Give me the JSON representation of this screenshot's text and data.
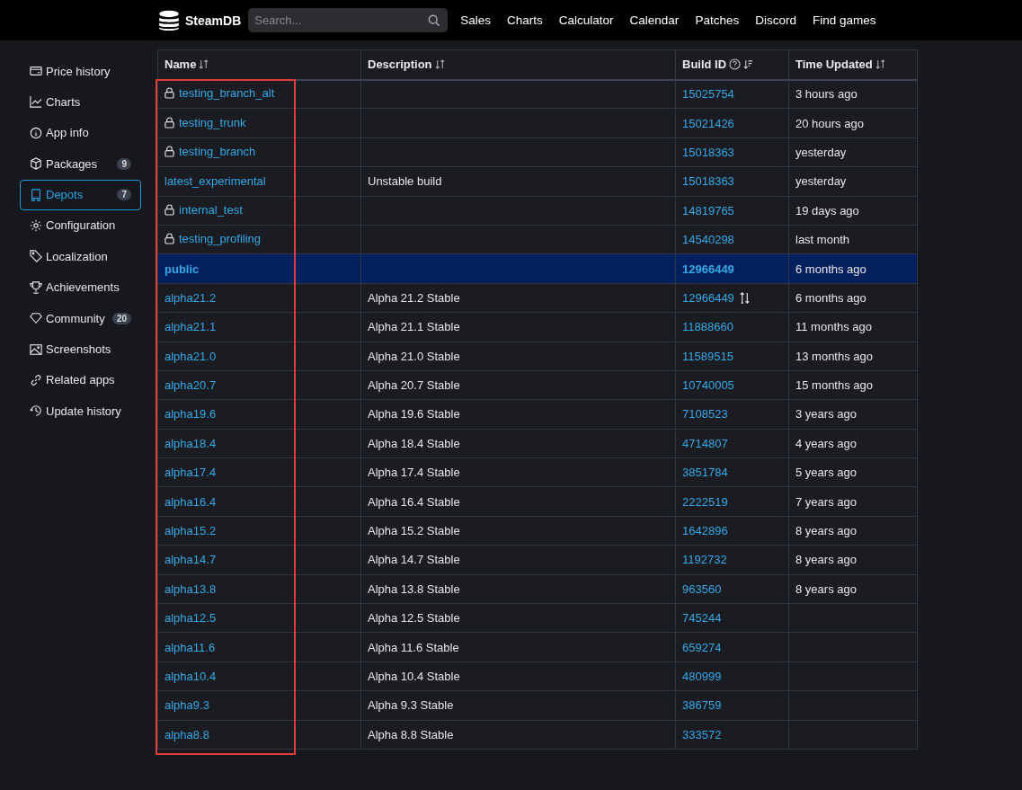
{
  "header": {
    "logo": "SteamDB",
    "search": {
      "placeholder": "Search..."
    },
    "nav": [
      "Sales",
      "Charts",
      "Calculator",
      "Calendar",
      "Patches",
      "Discord",
      "Find games"
    ]
  },
  "sidebar": {
    "items": [
      {
        "label": "Price history",
        "selected": false
      },
      {
        "label": "Charts",
        "selected": false
      },
      {
        "label": "App info",
        "selected": false
      },
      {
        "label": "Packages",
        "count": "9",
        "selected": false
      },
      {
        "label": "Depots",
        "count": "7",
        "selected": true
      },
      {
        "label": "Configuration",
        "selected": false
      },
      {
        "label": "Localization",
        "selected": false
      },
      {
        "label": "Achievements",
        "selected": false
      },
      {
        "label": "Community",
        "count": "20",
        "selected": false
      },
      {
        "label": "Screenshots",
        "selected": false
      },
      {
        "label": "Related apps",
        "selected": false
      },
      {
        "label": "Update history",
        "selected": false
      }
    ]
  },
  "table": {
    "columns": [
      {
        "label": "Name",
        "kind": "sort"
      },
      {
        "label": "Description",
        "kind": "sort"
      },
      {
        "label": "Build ID",
        "kind": "help-sorted"
      },
      {
        "label": "Time Updated",
        "kind": "sort"
      }
    ],
    "rows": [
      {
        "name": "testing_branch_alt",
        "locked": true,
        "build": "15025754",
        "time": "3 hours ago",
        "selected": false,
        "swapped": false
      },
      {
        "name": "testing_trunk",
        "locked": true,
        "build": "15021426",
        "time": "20 hours ago",
        "selected": false,
        "swapped": false
      },
      {
        "name": "testing_branch",
        "locked": true,
        "build": "15018363",
        "time": "yesterday",
        "selected": false,
        "swapped": false
      },
      {
        "name": "latest_experimental",
        "locked": false,
        "description": "Unstable build",
        "build": "15018363",
        "time": "yesterday",
        "selected": false,
        "swapped": false
      },
      {
        "name": "internal_test",
        "locked": true,
        "build": "14819765",
        "time": "19 days ago",
        "selected": false,
        "swapped": false
      },
      {
        "name": "testing_profiling",
        "locked": true,
        "build": "14540298",
        "time": "last month",
        "selected": false,
        "swapped": false
      },
      {
        "name": "public",
        "locked": false,
        "build": "12966449",
        "time": "6 months ago",
        "selected": true,
        "swapped": false
      },
      {
        "name": "alpha21.2",
        "locked": false,
        "description": "Alpha 21.2 Stable",
        "build": "12966449",
        "time": "6 months ago",
        "selected": false,
        "swapped": true
      },
      {
        "name": "alpha21.1",
        "locked": false,
        "description": "Alpha 21.1 Stable",
        "build": "11888660",
        "time": "11 months ago",
        "selected": false,
        "swapped": false
      },
      {
        "name": "alpha21.0",
        "locked": false,
        "description": "Alpha 21.0 Stable",
        "build": "11589515",
        "time": "13 months ago",
        "selected": false,
        "swapped": false
      },
      {
        "name": "alpha20.7",
        "locked": false,
        "description": "Alpha 20.7 Stable",
        "build": "10740005",
        "time": "15 months ago",
        "selected": false,
        "swapped": false
      },
      {
        "name": "alpha19.6",
        "locked": false,
        "description": "Alpha 19.6 Stable",
        "build": "7108523",
        "time": "3 years ago",
        "selected": false,
        "swapped": false
      },
      {
        "name": "alpha18.4",
        "locked": false,
        "description": "Alpha 18.4 Stable",
        "build": "4714807",
        "time": "4 years ago",
        "selected": false,
        "swapped": false
      },
      {
        "name": "alpha17.4",
        "locked": false,
        "description": "Alpha 17.4 Stable",
        "build": "3851784",
        "time": "5 years ago",
        "selected": false,
        "swapped": false
      },
      {
        "name": "alpha16.4",
        "locked": false,
        "description": "Alpha 16.4 Stable",
        "build": "2222519",
        "time": "7 years ago",
        "selected": false,
        "swapped": false
      },
      {
        "name": "alpha15.2",
        "locked": false,
        "description": "Alpha 15.2 Stable",
        "build": "1642896",
        "time": "8 years ago",
        "selected": false,
        "swapped": false
      },
      {
        "name": "alpha14.7",
        "locked": false,
        "description": "Alpha 14.7 Stable",
        "build": "1192732",
        "time": "8 years ago",
        "selected": false,
        "swapped": false
      },
      {
        "name": "alpha13.8",
        "locked": false,
        "description": "Alpha 13.8 Stable",
        "build": "963560",
        "time": "8 years ago",
        "selected": false,
        "swapped": false
      },
      {
        "name": "alpha12.5",
        "locked": false,
        "description": "Alpha 12.5 Stable",
        "build": "745244",
        "selected": false,
        "swapped": false
      },
      {
        "name": "alpha11.6",
        "locked": false,
        "description": "Alpha 11.6 Stable",
        "build": "659274",
        "selected": false,
        "swapped": false
      },
      {
        "name": "alpha10.4",
        "locked": false,
        "description": "Alpha 10.4 Stable",
        "build": "480999",
        "selected": false,
        "swapped": false
      },
      {
        "name": "alpha9.3",
        "locked": false,
        "description": "Alpha 9.3 Stable",
        "build": "386759",
        "selected": false,
        "swapped": false
      },
      {
        "name": "alpha8.8",
        "locked": false,
        "description": "Alpha 8.8 Stable",
        "build": "333572",
        "selected": false,
        "swapped": false
      }
    ]
  },
  "annotation": {
    "kind": "rectangle",
    "color": "#e03c3c"
  }
}
